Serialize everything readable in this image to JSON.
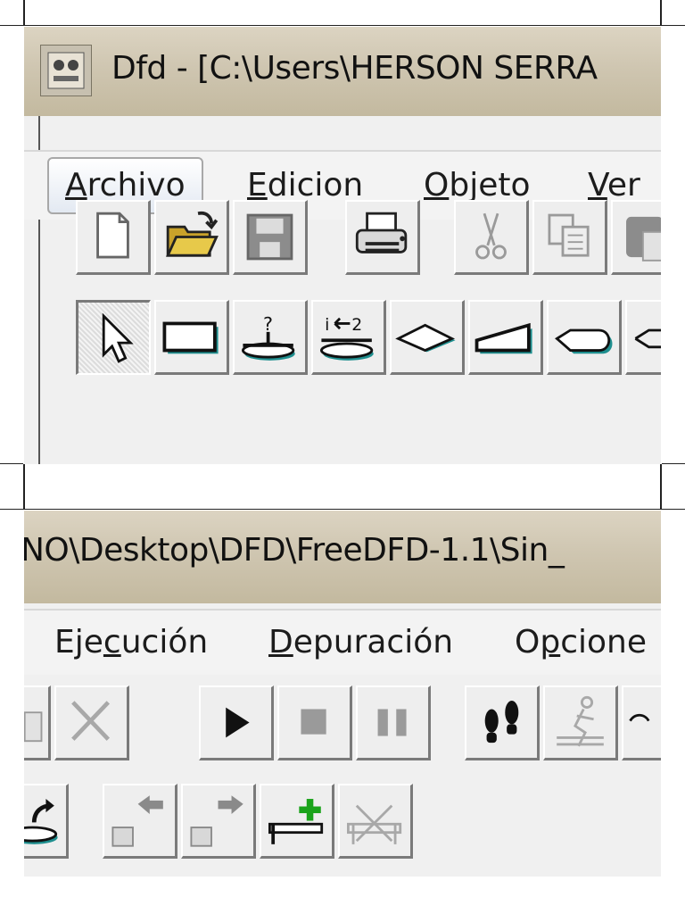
{
  "window": {
    "title_part1": "Dfd - [C:\\Users\\HERSON SERRA",
    "title_part2": "NO\\Desktop\\DFD\\FreeDFD-1.1\\Sin_"
  },
  "menu": {
    "archivo": {
      "pre": "",
      "ul": "A",
      "post": "rchivo"
    },
    "edicion": {
      "pre": "",
      "ul": "E",
      "post": "dicion"
    },
    "objeto": {
      "pre": "",
      "ul": "O",
      "post": "bjeto"
    },
    "ver": {
      "pre": "",
      "ul": "V",
      "post": "er"
    },
    "ejecucion": {
      "pre": "Eje",
      "ul": "c",
      "post": "ución"
    },
    "depuracion": {
      "pre": "",
      "ul": "D",
      "post": "epuración"
    },
    "opciones": {
      "pre": "O",
      "ul": "p",
      "post": "cione"
    }
  },
  "colors": {
    "folder": "#e7c94a",
    "icon_gray": "#9a9a9a",
    "accent_teal": "#1f8f8f",
    "plus_green": "#1aa31a"
  }
}
